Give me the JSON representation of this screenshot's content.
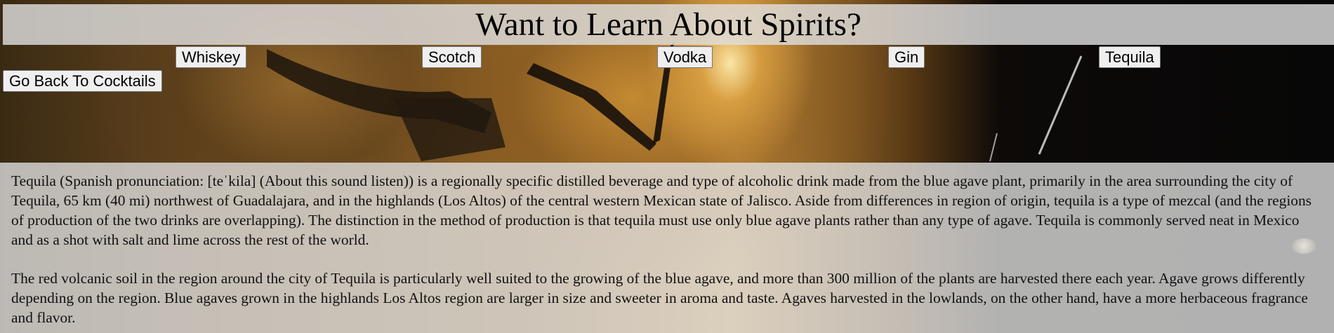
{
  "header": {
    "title": "Want to Learn About Spirits?"
  },
  "nav": {
    "spirits": [
      {
        "label": "Whiskey"
      },
      {
        "label": "Scotch"
      },
      {
        "label": "Vodka"
      },
      {
        "label": "Gin"
      },
      {
        "label": "Tequila"
      }
    ],
    "back_label": "Go Back To Cocktails"
  },
  "article": {
    "paragraphs": [
      "Tequila (Spanish pronunciation: [teˈkila] (About this sound listen)) is a regionally specific distilled beverage and type of alcoholic drink made from the blue agave plant, primarily in the area surrounding the city of Tequila, 65 km (40 mi) northwest of Guadalajara, and in the highlands (Los Altos) of the central western Mexican state of Jalisco. Aside from differences in region of origin, tequila is a type of mezcal (and the regions of production of the two drinks are overlapping). The distinction in the method of production is that tequila must use only blue agave plants rather than any type of agave. Tequila is commonly served neat in Mexico and as a shot with salt and lime across the rest of the world.",
      "The red volcanic soil in the region around the city of Tequila is particularly well suited to the growing of the blue agave, and more than 300 million of the plants are harvested there each year. Agave grows differently depending on the region. Blue agaves grown in the highlands Los Altos region are larger in size and sweeter in aroma and taste. Agaves harvested in the lowlands, on the other hand, have a more herbaceous fragrance and flavor."
    ]
  },
  "colors": {
    "panel_bg": "#dedede",
    "button_bg": "#efefef",
    "button_border": "#767676",
    "text": "#111111"
  }
}
